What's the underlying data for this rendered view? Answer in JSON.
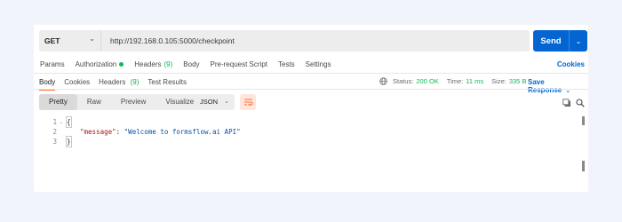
{
  "request": {
    "method": "GET",
    "url": "http://192.168.0.105:5000/checkpoint",
    "send_label": "Send"
  },
  "request_tabs": {
    "params": "Params",
    "authorization": "Authorization",
    "headers": "Headers",
    "headers_count": "(9)",
    "body": "Body",
    "prerequest": "Pre-request Script",
    "tests": "Tests",
    "settings": "Settings",
    "cookies": "Cookies"
  },
  "response_tabs": {
    "body": "Body",
    "cookies": "Cookies",
    "headers": "Headers",
    "headers_count": "(9)",
    "test_results": "Test Results"
  },
  "status": {
    "status_label": "Status:",
    "status_value": "200 OK",
    "time_label": "Time:",
    "time_value": "11 ms",
    "size_label": "Size:",
    "size_value": "335 B",
    "save_response": "Save Response"
  },
  "view": {
    "pretty": "Pretty",
    "raw": "Raw",
    "preview": "Preview",
    "visualize": "Visualize",
    "format": "JSON"
  },
  "code": {
    "line1_num": "1",
    "line2_num": "2",
    "line3_num": "3",
    "open": "{",
    "key": "\"message\"",
    "colon": ": ",
    "value": "\"Welcome to formsflow.ai API\"",
    "close": "}"
  },
  "colors": {
    "accent": "#0265d2",
    "success": "#0cbb52",
    "highlight": "#ff6c37"
  }
}
